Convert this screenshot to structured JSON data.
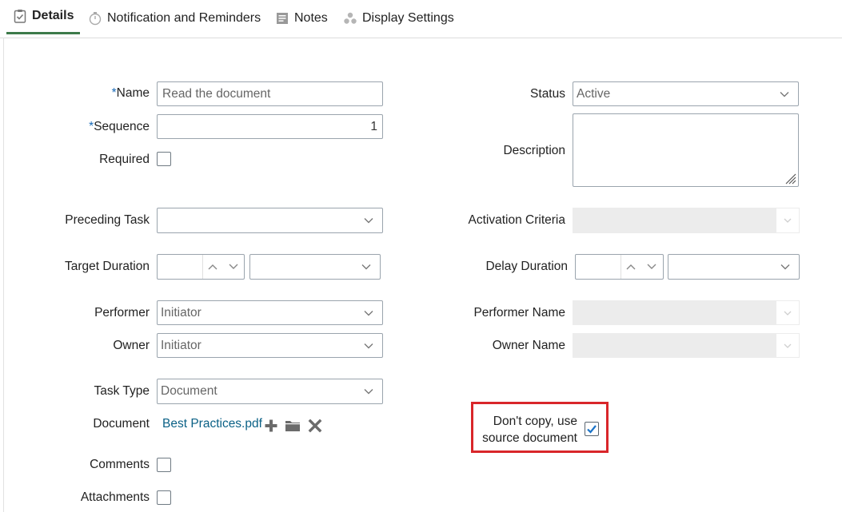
{
  "tabs": [
    {
      "label": "Details",
      "icon": "clipboard-check-icon",
      "active": true
    },
    {
      "label": "Notification and Reminders",
      "icon": "stopwatch-icon"
    },
    {
      "label": "Notes",
      "icon": "note-icon"
    },
    {
      "label": "Display Settings",
      "icon": "dots-cluster-icon"
    }
  ],
  "form": {
    "name": {
      "required_mark": "*",
      "label": "Name",
      "value": "Read the document"
    },
    "sequence": {
      "required_mark": "*",
      "label": "Sequence",
      "value": "1"
    },
    "required": {
      "label": "Required",
      "checked": false
    },
    "preceding_task": {
      "label": "Preceding Task",
      "value": ""
    },
    "target_duration": {
      "label": "Target Duration",
      "value": "",
      "unit": ""
    },
    "performer": {
      "label": "Performer",
      "value": "Initiator"
    },
    "owner": {
      "label": "Owner",
      "value": "Initiator"
    },
    "task_type": {
      "label": "Task Type",
      "value": "Document"
    },
    "document": {
      "label": "Document",
      "file": "Best Practices.pdf",
      "actions": [
        "plus-icon",
        "folder-icon",
        "close-x-icon"
      ]
    },
    "comments": {
      "label": "Comments",
      "checked": false
    },
    "attachments": {
      "label": "Attachments",
      "checked": false
    },
    "status": {
      "label": "Status",
      "value": "Active"
    },
    "description": {
      "label": "Description",
      "value": ""
    },
    "activation_criteria": {
      "label": "Activation Criteria",
      "value": ""
    },
    "delay_duration": {
      "label": "Delay Duration",
      "value": "",
      "unit": ""
    },
    "performer_name": {
      "label": "Performer Name",
      "value": ""
    },
    "owner_name": {
      "label": "Owner Name",
      "value": ""
    },
    "dont_copy": {
      "label_line1": "Don't copy, use",
      "label_line2": "source document",
      "checked": true
    }
  },
  "colors": {
    "accent_tab": "#3d7a4a",
    "link": "#0b6186",
    "required": "#1a6bb8",
    "highlight": "#d9262a",
    "check": "#1a73c8"
  }
}
